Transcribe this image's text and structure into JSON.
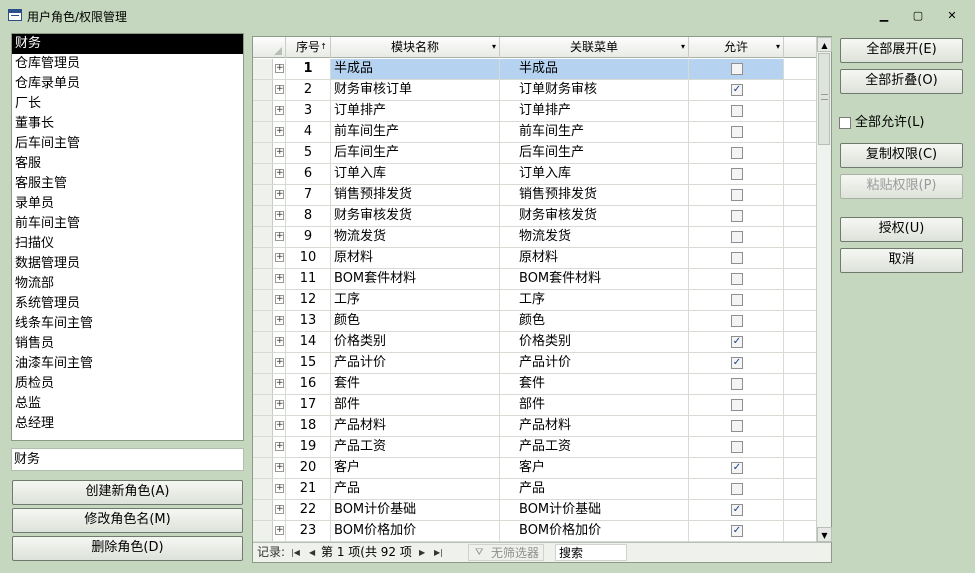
{
  "window": {
    "title": "用户角色/权限管理",
    "min_glyph": "▁",
    "max_glyph": "▢",
    "close_glyph": "✕"
  },
  "roles": {
    "items": [
      "财务",
      "仓库管理员",
      "仓库录单员",
      "厂长",
      "董事长",
      "后车间主管",
      "客服",
      "客服主管",
      "录单员",
      "前车间主管",
      "扫描仪",
      "数据管理员",
      "物流部",
      "系统管理员",
      "线条车间主管",
      "销售员",
      "油漆车间主管",
      "质检员",
      "总监",
      "总经理"
    ],
    "selected": "财务",
    "name_value": "财务",
    "create_label": "创建新角色(A)",
    "rename_label": "修改角色名(M)",
    "delete_label": "删除角色(D)"
  },
  "grid": {
    "columns": {
      "seq": "序号",
      "module": "模块名称",
      "menu": "关联菜单",
      "allow": "允许"
    },
    "sort_glyph": "↑",
    "dropdown_glyph": "▾",
    "current_row": 1,
    "rows": [
      {
        "seq": "1",
        "module": "半成品",
        "menu": "半成品",
        "allow": false
      },
      {
        "seq": "2",
        "module": "财务审核订单",
        "menu": "订单财务审核",
        "allow": true
      },
      {
        "seq": "3",
        "module": "订单排产",
        "menu": "订单排产",
        "allow": false
      },
      {
        "seq": "4",
        "module": "前车间生产",
        "menu": "前车间生产",
        "allow": false
      },
      {
        "seq": "5",
        "module": "后车间生产",
        "menu": "后车间生产",
        "allow": false
      },
      {
        "seq": "6",
        "module": "订单入库",
        "menu": "订单入库",
        "allow": false
      },
      {
        "seq": "7",
        "module": "销售预排发货",
        "menu": "销售预排发货",
        "allow": false
      },
      {
        "seq": "8",
        "module": "财务审核发货",
        "menu": "财务审核发货",
        "allow": false
      },
      {
        "seq": "9",
        "module": "物流发货",
        "menu": "物流发货",
        "allow": false
      },
      {
        "seq": "10",
        "module": "原材料",
        "menu": "原材料",
        "allow": false
      },
      {
        "seq": "11",
        "module": "BOM套件材料",
        "menu": "BOM套件材料",
        "allow": false
      },
      {
        "seq": "12",
        "module": "工序",
        "menu": "工序",
        "allow": false
      },
      {
        "seq": "13",
        "module": "颜色",
        "menu": "颜色",
        "allow": false
      },
      {
        "seq": "14",
        "module": "价格类别",
        "menu": "价格类别",
        "allow": true
      },
      {
        "seq": "15",
        "module": "产品计价",
        "menu": "产品计价",
        "allow": true
      },
      {
        "seq": "16",
        "module": "套件",
        "menu": "套件",
        "allow": false
      },
      {
        "seq": "17",
        "module": "部件",
        "menu": "部件",
        "allow": false
      },
      {
        "seq": "18",
        "module": "产品材料",
        "menu": "产品材料",
        "allow": false
      },
      {
        "seq": "19",
        "module": "产品工资",
        "menu": "产品工资",
        "allow": false
      },
      {
        "seq": "20",
        "module": "客户",
        "menu": "客户",
        "allow": true
      },
      {
        "seq": "21",
        "module": "产品",
        "menu": "产品",
        "allow": false
      },
      {
        "seq": "22",
        "module": "BOM计价基础",
        "menu": "BOM计价基础",
        "allow": true
      },
      {
        "seq": "23",
        "module": "BOM价格加价",
        "menu": "BOM价格加价",
        "allow": true
      }
    ],
    "expander_glyph": "+",
    "check_glyph": "✓"
  },
  "navbar": {
    "label": "记录:",
    "first": "|◀",
    "prev": "◀",
    "next": "▶",
    "last": "▶|",
    "position": "第 1 项(共 92 项",
    "filter": "无筛选器",
    "search": "搜索"
  },
  "scrollbar": {
    "up": "▲",
    "down": "▼"
  },
  "actions": {
    "expand_all": "全部展开(E)",
    "collapse_all": "全部折叠(O)",
    "allow_all": "全部允许(L)",
    "copy": "复制权限(C)",
    "paste": "粘贴权限(P)",
    "grant": "授权(U)",
    "cancel": "取消"
  }
}
